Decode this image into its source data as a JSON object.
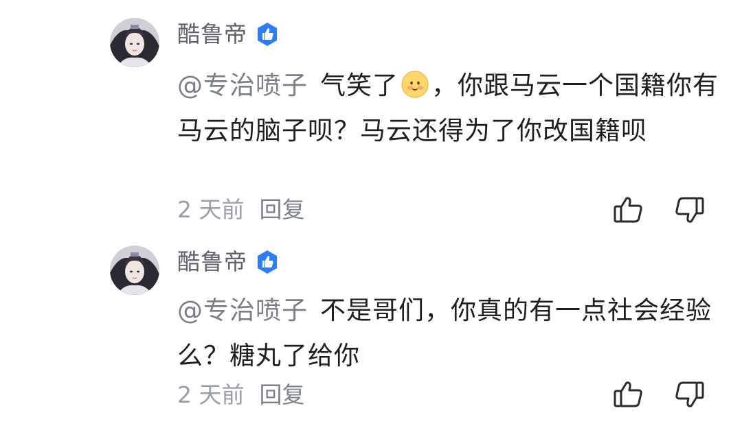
{
  "comments": [
    {
      "username": "酷鲁帝",
      "verified_icon": "verified-thumb-badge-icon",
      "mention": "@专治喷子",
      "text_before_emoji": "气笑了",
      "emoji": "smiling-face-emoji",
      "text_after_emoji": "，你跟马云一个国籍你有马云的脑子呗？马云还得为了你改国籍呗",
      "time": "2 天前",
      "reply_label": "回复"
    },
    {
      "username": "酷鲁帝",
      "verified_icon": "verified-thumb-badge-icon",
      "mention": "@专治喷子",
      "text": "不是哥们，你真的有一点社会经验么？糖丸了给你",
      "time": "2 天前",
      "reply_label": "回复"
    }
  ],
  "colors": {
    "username": "#5f6368",
    "mention": "#7a7e85",
    "body_text": "#1f1f1f",
    "meta": "#9a9ea5",
    "verify_badge": "#2e7cf6"
  }
}
